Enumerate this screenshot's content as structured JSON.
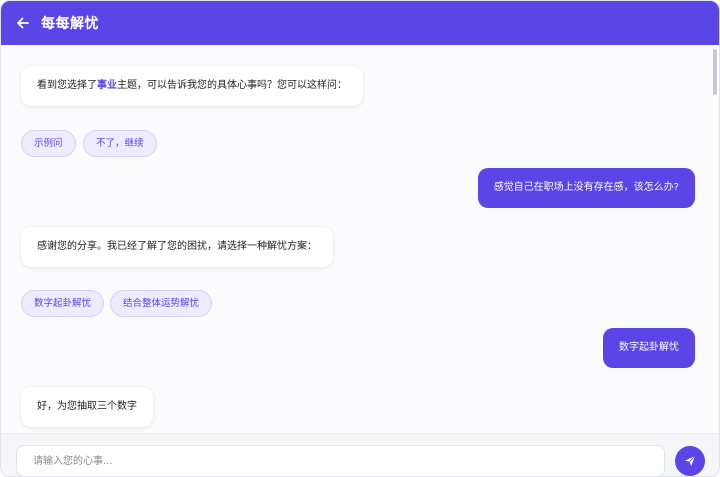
{
  "header": {
    "title": "每每解忧"
  },
  "messages": {
    "bot1": {
      "prefix": "看到您选择了",
      "highlight": "事业",
      "suffix": "主题，可以告诉我您的具体心事吗？您可以这样问："
    },
    "chips1": [
      "示例问",
      "不了，继续"
    ],
    "user1": "感觉自己在职场上没有存在感，该怎么办?",
    "bot2": "感谢您的分享。我已经了解了您的困扰，请选择一种解忧方案：",
    "chips2": [
      "数字起卦解忧",
      "结合整体运势解忧"
    ],
    "user2": "数字起卦解忧",
    "bot3": "好，为您抽取三个数字"
  },
  "input": {
    "placeholder": "请输入您的心事..."
  },
  "colors": {
    "accent": "#5b45e6",
    "chip_bg": "#eeeaff"
  }
}
